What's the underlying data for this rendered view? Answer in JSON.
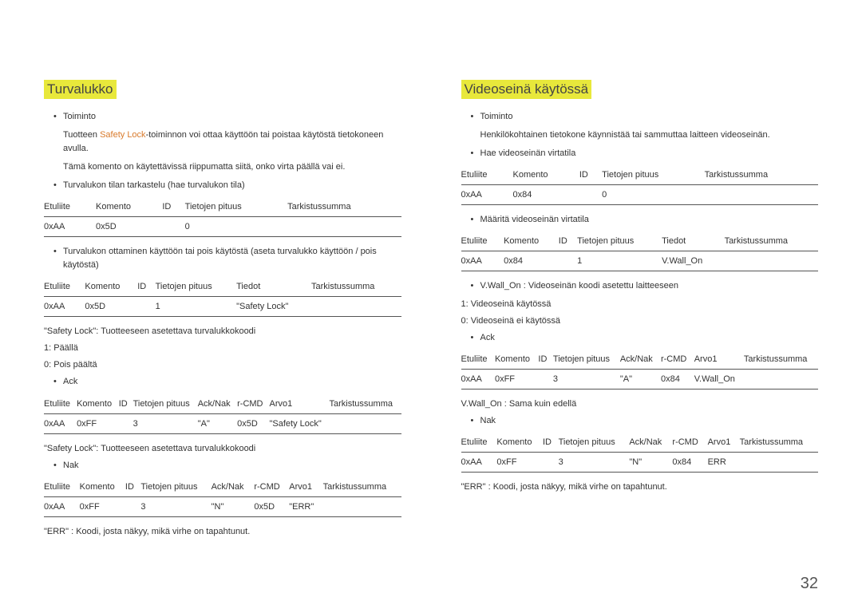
{
  "page_number": "32",
  "left": {
    "heading": "Turvalukko",
    "b1_label": "Toiminto",
    "b1_text_pre": "Tuotteen ",
    "b1_text_accent": "Safety Lock",
    "b1_text_post": "-toiminnon voi ottaa käyttöön tai poistaa käytöstä tietokoneen avulla.",
    "b1_text2": "Tämä komento on käytettävissä riippumatta siitä, onko virta päällä vai ei.",
    "b2": "Turvalukon tilan tarkastelu (hae turvalukon tila)",
    "t1": {
      "h": [
        "Etuliite",
        "Komento",
        "ID",
        "Tietojen pituus",
        "Tarkistussumma"
      ],
      "r": [
        "0xAA",
        "0x5D",
        "",
        "0",
        ""
      ]
    },
    "b3": "Turvalukon ottaminen käyttöön tai pois käytöstä (aseta turvalukko käyttöön / pois käytöstä)",
    "t2": {
      "h": [
        "Etuliite",
        "Komento",
        "ID",
        "Tietojen pituus",
        "Tiedot",
        "Tarkistussumma"
      ],
      "r": [
        "0xAA",
        "0x5D",
        "",
        "1",
        "\"Safety Lock\"",
        ""
      ]
    },
    "p1": "\"Safety Lock\": Tuotteeseen asetettava turvalukkokoodi",
    "p2": "1: Päällä",
    "p3": "0: Pois päältä",
    "b4": "Ack",
    "t3": {
      "h": [
        "Etuliite",
        "Komento",
        "ID",
        "Tietojen pituus",
        "Ack/Nak",
        "r-CMD",
        "Arvo1",
        "Tarkistussumma"
      ],
      "r": [
        "0xAA",
        "0xFF",
        "",
        "3",
        "\"A\"",
        "0x5D",
        "\"Safety Lock\"",
        ""
      ]
    },
    "p4": "\"Safety Lock\": Tuotteeseen asetettava turvalukkokoodi",
    "b5": "Nak",
    "t4": {
      "h": [
        "Etuliite",
        "Komento",
        "ID",
        "Tietojen pituus",
        "Ack/Nak",
        "r-CMD",
        "Arvo1",
        "Tarkistussumma"
      ],
      "r": [
        "0xAA",
        "0xFF",
        "",
        "3",
        "\"N\"",
        "0x5D",
        "\"ERR\"",
        ""
      ]
    },
    "p5": "\"ERR\" : Koodi, josta näkyy, mikä virhe on tapahtunut."
  },
  "right": {
    "heading": "Videoseinä käytössä",
    "b1_label": "Toiminto",
    "b1_text": "Henkilökohtainen tietokone käynnistää tai sammuttaa laitteen videoseinän.",
    "b2": "Hae videoseinän virtatila",
    "t1": {
      "h": [
        "Etuliite",
        "Komento",
        "ID",
        "Tietojen pituus",
        "Tarkistussumma"
      ],
      "r": [
        "0xAA",
        "0x84",
        "",
        "0",
        ""
      ]
    },
    "b3": "Määritä videoseinän virtatila",
    "t2": {
      "h": [
        "Etuliite",
        "Komento",
        "ID",
        "Tietojen pituus",
        "Tiedot",
        "Tarkistussumma"
      ],
      "r": [
        "0xAA",
        "0x84",
        "",
        "1",
        "V.Wall_On",
        ""
      ]
    },
    "b4": "V.Wall_On : Videoseinän koodi asetettu laitteeseen",
    "p1": "1: Videoseinä käytössä",
    "p2": "0: Videoseinä ei käytössä",
    "b5": "Ack",
    "t3": {
      "h": [
        "Etuliite",
        "Komento",
        "ID",
        "Tietojen pituus",
        "Ack/Nak",
        "r-CMD",
        "Arvo1",
        "Tarkistussumma"
      ],
      "r": [
        "0xAA",
        "0xFF",
        "",
        "3",
        "\"A\"",
        "0x84",
        "V.Wall_On",
        ""
      ]
    },
    "p3": "V.Wall_On : Sama kuin edellä",
    "b6": "Nak",
    "t4": {
      "h": [
        "Etuliite",
        "Komento",
        "ID",
        "Tietojen pituus",
        "Ack/Nak",
        "r-CMD",
        "Arvo1",
        "Tarkistussumma"
      ],
      "r": [
        "0xAA",
        "0xFF",
        "",
        "3",
        "\"N\"",
        "0x84",
        "ERR",
        ""
      ]
    },
    "p4": "\"ERR\" : Koodi, josta näkyy, mikä virhe on tapahtunut."
  }
}
